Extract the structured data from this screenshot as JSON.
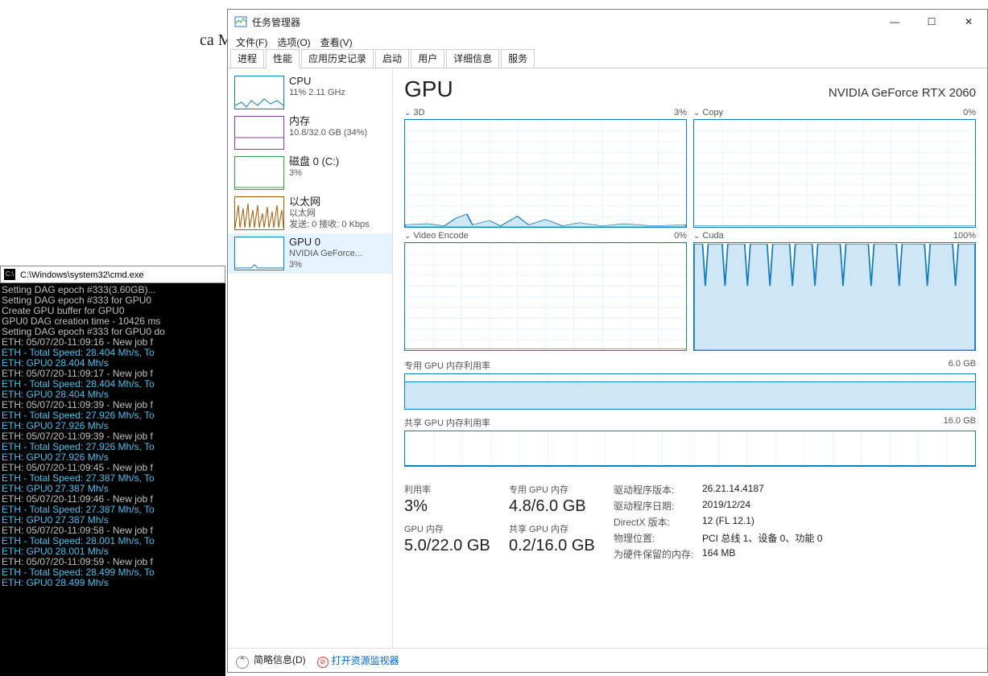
{
  "bg_text": "ca\nMa\npu\n\nTh\n\nFo\not\nfro",
  "cmd": {
    "title": "C:\\Windows\\system32\\cmd.exe",
    "lines": [
      {
        "t": "Setting DAG epoch #333(3.60GB)...",
        "c": 0
      },
      {
        "t": "Setting DAG epoch #333 for GPU0",
        "c": 0
      },
      {
        "t": "Create GPU buffer for GPU0",
        "c": 0
      },
      {
        "t": "GPU0 DAG creation time - 10426 ms",
        "c": 0
      },
      {
        "t": "Setting DAG epoch #333 for GPU0 do",
        "c": 0
      },
      {
        "t": "ETH: 05/07/20-11:09:16 - New job f",
        "c": 0
      },
      {
        "t": "ETH - Total Speed: 28.404 Mh/s, To",
        "c": 1
      },
      {
        "t": "ETH: GPU0 28.404 Mh/s",
        "c": 1
      },
      {
        "t": "ETH: 05/07/20-11:09:17 - New job f",
        "c": 0
      },
      {
        "t": "ETH - Total Speed: 28.404 Mh/s, To",
        "c": 1
      },
      {
        "t": "ETH: GPU0 28.404 Mh/s",
        "c": 1
      },
      {
        "t": "ETH: 05/07/20-11:09:39 - New job f",
        "c": 0
      },
      {
        "t": "ETH - Total Speed: 27.926 Mh/s, To",
        "c": 1
      },
      {
        "t": "ETH: GPU0 27.926 Mh/s",
        "c": 1
      },
      {
        "t": "ETH: 05/07/20-11:09:39 - New job f",
        "c": 0
      },
      {
        "t": "ETH - Total Speed: 27.926 Mh/s, To",
        "c": 1
      },
      {
        "t": "ETH: GPU0 27.926 Mh/s",
        "c": 1
      },
      {
        "t": "ETH: 05/07/20-11:09:45 - New job f",
        "c": 0
      },
      {
        "t": "ETH - Total Speed: 27.387 Mh/s, To",
        "c": 1
      },
      {
        "t": "ETH: GPU0 27.387 Mh/s",
        "c": 1
      },
      {
        "t": "ETH: 05/07/20-11:09:46 - New job f",
        "c": 0
      },
      {
        "t": "ETH - Total Speed: 27.387 Mh/s, To",
        "c": 1
      },
      {
        "t": "ETH: GPU0 27.387 Mh/s",
        "c": 1
      },
      {
        "t": "ETH: 05/07/20-11:09:58 - New job f",
        "c": 0
      },
      {
        "t": "ETH - Total Speed: 28.001 Mh/s, To",
        "c": 1
      },
      {
        "t": "ETH: GPU0 28.001 Mh/s",
        "c": 1
      },
      {
        "t": "ETH: 05/07/20-11:09:59 - New job f",
        "c": 0
      },
      {
        "t": "ETH - Total Speed: 28.499 Mh/s, To",
        "c": 1
      },
      {
        "t": "ETH: GPU0 28.499 Mh/s",
        "c": 1
      }
    ]
  },
  "tm": {
    "title": "任务管理器",
    "menu": [
      "文件(F)",
      "选项(O)",
      "查看(V)"
    ],
    "tabs": [
      "进程",
      "性能",
      "应用历史记录",
      "启动",
      "用户",
      "详细信息",
      "服务"
    ],
    "active_tab": 1,
    "sidebar": [
      {
        "title": "CPU",
        "sub": "11%  2.11 GHz"
      },
      {
        "title": "内存",
        "sub": "10.8/32.0 GB (34%)"
      },
      {
        "title": "磁盘 0 (C:)",
        "sub": "3%"
      },
      {
        "title": "以太网",
        "sub": "以太网",
        "sub2": "发送: 0  接收: 0 Kbps"
      },
      {
        "title": "GPU 0",
        "sub": "NVIDIA GeForce...",
        "sub2": "3%"
      }
    ],
    "main": {
      "title": "GPU",
      "gpu_name": "NVIDIA GeForce RTX 2060",
      "charts": [
        {
          "label": "3D",
          "pct": "3%"
        },
        {
          "label": "Copy",
          "pct": "0%"
        },
        {
          "label": "Video Encode",
          "pct": "0%"
        },
        {
          "label": "Cuda",
          "pct": "100%"
        }
      ],
      "mem": [
        {
          "label": "专用 GPU 内存利用率",
          "max": "6.0 GB"
        },
        {
          "label": "共享 GPU 内存利用率",
          "max": "16.0 GB"
        }
      ],
      "stats": {
        "util_lbl": "利用率",
        "util": "3%",
        "gpumem_lbl": "GPU 内存",
        "gpumem": "5.0/22.0 GB",
        "ded_lbl": "专用 GPU 内存",
        "ded": "4.8/6.0 GB",
        "shr_lbl": "共享 GPU 内存",
        "shr": "0.2/16.0 GB"
      },
      "driver": [
        {
          "k": "驱动程序版本:",
          "v": "26.21.14.4187"
        },
        {
          "k": "驱动程序日期:",
          "v": "2019/12/24"
        },
        {
          "k": "DirectX 版本:",
          "v": "12 (FL 12.1)"
        },
        {
          "k": "物理位置:",
          "v": "PCI 总线 1、设备 0、功能 0"
        },
        {
          "k": "为硬件保留的内存:",
          "v": "164 MB"
        }
      ]
    },
    "footer": {
      "less": "简略信息(D)",
      "rmon": "打开资源监视器"
    }
  }
}
